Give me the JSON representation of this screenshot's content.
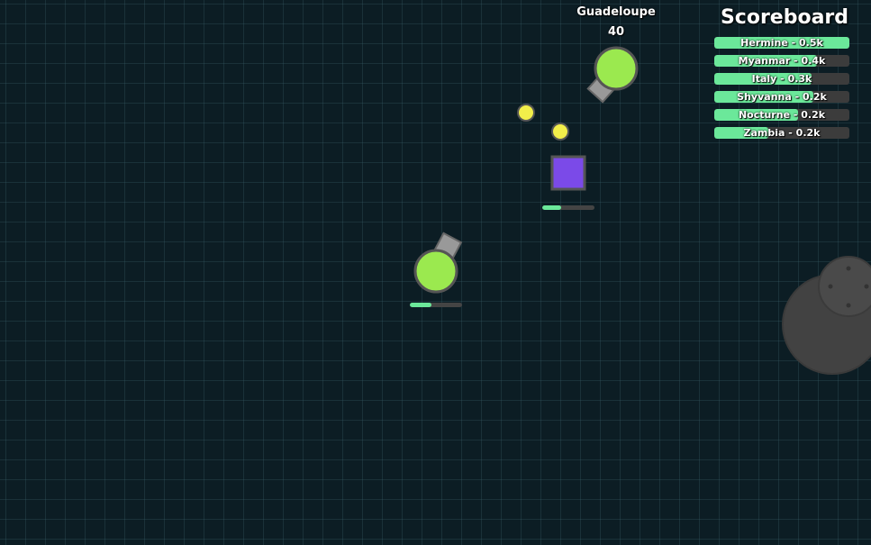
{
  "scoreboard": {
    "title": "Scoreboard",
    "entries": [
      {
        "label": "Hermine - 0.5k",
        "fill": 1.0
      },
      {
        "label": "Myanmar - 0.4k",
        "fill": 0.76
      },
      {
        "label": "Italy - 0.3k",
        "fill": 0.72
      },
      {
        "label": "Shyvanna - 0.2k",
        "fill": 0.73
      },
      {
        "label": "Nocturne - 0.2k",
        "fill": 0.62
      },
      {
        "label": "Zambia - 0.2k",
        "fill": 0.4
      }
    ]
  },
  "player_top": {
    "name": "Guadeloupe",
    "score": "40"
  },
  "player_center": {
    "health": 0.42
  },
  "square_shape": {
    "health": 0.36
  },
  "colors": {
    "tank_body": "#9be94f",
    "tank_outline": "#555555",
    "barrel": "#999999",
    "bullet": "#f2ee4a",
    "square": "#7b4ae8",
    "health_fill": "#6be89a",
    "dark_bg": "#0c1d24",
    "rock": "#424242"
  }
}
